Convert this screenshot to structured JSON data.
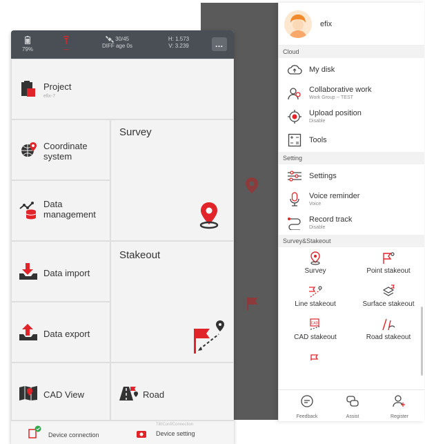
{
  "statusbar": {
    "battery": "79%",
    "signal_value": "—",
    "satellites": "30/45",
    "diff_age": "DIFF age 0s",
    "h_precision": "H: 1.573",
    "v_precision": "V: 3.239",
    "more_label": "…"
  },
  "home": {
    "project": {
      "label": "Project",
      "sub": "efix-7"
    },
    "survey": {
      "label": "Survey"
    },
    "coordinate_system": {
      "label": "Coordinate system"
    },
    "data_management": {
      "label": "Data management"
    },
    "data_import": {
      "label": "Data import"
    },
    "stakeout": {
      "label": "Stakeout"
    },
    "data_export": {
      "label": "Data export"
    },
    "cad_view": {
      "label": "CAD View"
    },
    "road": {
      "label": "Road"
    }
  },
  "footer": {
    "device_connection": "Device connection",
    "device_setting": "Device setting",
    "device_setting_hint": "Tilt/Conf/Connection"
  },
  "drawer": {
    "username": "efix",
    "sections": {
      "cloud": "Cloud",
      "setting": "Setting",
      "survey_stakeout": "Survey&Stakeout"
    },
    "cloud_items": [
      {
        "title": "My disk",
        "subtitle": ""
      },
      {
        "title": "Collaborative work",
        "subtitle": "Work Group -- TEST"
      },
      {
        "title": "Upload position",
        "subtitle": "Disable"
      },
      {
        "title": "Tools",
        "subtitle": ""
      }
    ],
    "setting_items": [
      {
        "title": "Settings",
        "subtitle": ""
      },
      {
        "title": "Voice reminder",
        "subtitle": "Voice"
      },
      {
        "title": "Record track",
        "subtitle": "Disable"
      }
    ],
    "survey_stakeout_items": [
      "Survey",
      "Point stakeout",
      "Line stakeout",
      "Surface stakeout",
      "CAD stakeout",
      "Road stakeout"
    ],
    "bottom": {
      "feedback": "Feedback",
      "assist": "Assist",
      "register": "Register"
    }
  },
  "colors": {
    "accent_red": "#e0242a",
    "statusbar_bg": "#4a4f55",
    "tile_bg": "#f3f3f3"
  }
}
